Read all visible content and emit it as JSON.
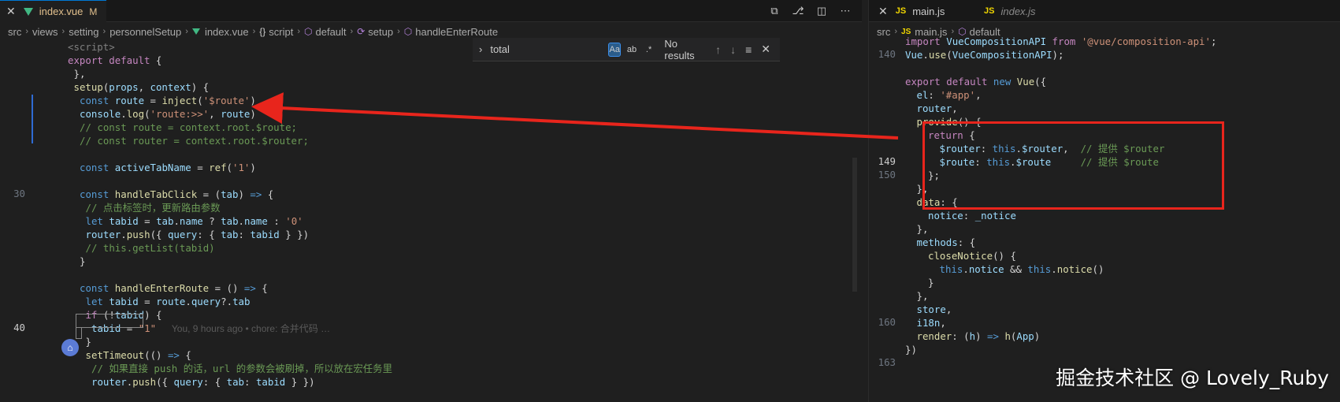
{
  "left": {
    "tab": {
      "label": "index.vue",
      "badge": "M"
    },
    "breadcrumb": [
      "src",
      "views",
      "setting",
      "personnelSetup",
      "index.vue",
      "script",
      "default",
      "setup",
      "handleEnterRoute"
    ],
    "find": {
      "query": "total",
      "results": "No results",
      "case_label": "Aa",
      "word_label": "ab",
      "regex_label": ".*"
    },
    "lines": [
      {
        "n": "",
        "tokens": [
          [
            "tag",
            "<script>"
          ]
        ],
        "indent": 4
      },
      {
        "n": "",
        "tokens": [
          [
            "kw2",
            "export"
          ],
          [
            "pl",
            " "
          ],
          [
            "kw2",
            "default"
          ],
          [
            "pl",
            " {"
          ]
        ],
        "indent": 4
      },
      {
        "n": "",
        "tokens": [
          [
            "pl",
            "},"
          ]
        ],
        "indent": 5
      },
      {
        "n": "",
        "tokens": [
          [
            "fn",
            "setup"
          ],
          [
            "pl",
            "("
          ],
          [
            "var",
            "props"
          ],
          [
            "pl",
            ", "
          ],
          [
            "var",
            "context"
          ],
          [
            "pl",
            ") {"
          ]
        ],
        "indent": 5
      },
      {
        "n": "",
        "tokens": [
          [
            "kw",
            "const"
          ],
          [
            "pl",
            " "
          ],
          [
            "var",
            "route"
          ],
          [
            "pl",
            " = "
          ],
          [
            "fn",
            "inject"
          ],
          [
            "pl",
            "("
          ],
          [
            "str",
            "'$route'"
          ],
          [
            "pl",
            ")"
          ]
        ],
        "indent": 6
      },
      {
        "n": "",
        "tokens": [
          [
            "var",
            "console"
          ],
          [
            "pl",
            "."
          ],
          [
            "fn",
            "log"
          ],
          [
            "pl",
            "("
          ],
          [
            "str",
            "'route:>>'"
          ],
          [
            "pl",
            ", "
          ],
          [
            "var",
            "route"
          ],
          [
            "pl",
            ")"
          ]
        ],
        "indent": 6
      },
      {
        "n": "",
        "tokens": [
          [
            "cm",
            "// const route = context.root.$route;"
          ]
        ],
        "indent": 6
      },
      {
        "n": "",
        "tokens": [
          [
            "cm",
            "// const router = context.root.$router;"
          ]
        ],
        "indent": 6
      },
      {
        "n": "",
        "tokens": [],
        "indent": 0
      },
      {
        "n": "",
        "tokens": [
          [
            "kw",
            "const"
          ],
          [
            "pl",
            " "
          ],
          [
            "var",
            "activeTabName"
          ],
          [
            "pl",
            " = "
          ],
          [
            "fn",
            "ref"
          ],
          [
            "pl",
            "("
          ],
          [
            "str",
            "'1'"
          ],
          [
            "pl",
            ")"
          ]
        ],
        "indent": 6
      },
      {
        "n": "",
        "tokens": [],
        "indent": 0
      },
      {
        "n": "30",
        "tokens": [
          [
            "kw",
            "const"
          ],
          [
            "pl",
            " "
          ],
          [
            "fn",
            "handleTabClick"
          ],
          [
            "pl",
            " = ("
          ],
          [
            "var",
            "tab"
          ],
          [
            "pl",
            ") "
          ],
          [
            "kw",
            "=>"
          ],
          [
            "pl",
            " {"
          ]
        ],
        "indent": 6
      },
      {
        "n": "",
        "tokens": [
          [
            "cm",
            "// 点击标签时，更新路由参数"
          ]
        ],
        "indent": 7
      },
      {
        "n": "",
        "tokens": [
          [
            "kw",
            "let"
          ],
          [
            "pl",
            " "
          ],
          [
            "var",
            "tabid"
          ],
          [
            "pl",
            " = "
          ],
          [
            "var",
            "tab"
          ],
          [
            "pl",
            "."
          ],
          [
            "var",
            "name"
          ],
          [
            "pl",
            " ? "
          ],
          [
            "var",
            "tab"
          ],
          [
            "pl",
            "."
          ],
          [
            "var",
            "name"
          ],
          [
            "pl",
            " : "
          ],
          [
            "str",
            "'0'"
          ]
        ],
        "indent": 7
      },
      {
        "n": "",
        "tokens": [
          [
            "var",
            "router"
          ],
          [
            "pl",
            "."
          ],
          [
            "fn",
            "push"
          ],
          [
            "pl",
            "({ "
          ],
          [
            "var",
            "query"
          ],
          [
            "pl",
            ": { "
          ],
          [
            "var",
            "tab"
          ],
          [
            "pl",
            ": "
          ],
          [
            "var",
            "tabid"
          ],
          [
            "pl",
            " } })"
          ]
        ],
        "indent": 7
      },
      {
        "n": "",
        "tokens": [
          [
            "cm",
            "// this.getList(tabid)"
          ]
        ],
        "indent": 7
      },
      {
        "n": "",
        "tokens": [
          [
            "pl",
            "}"
          ]
        ],
        "indent": 6
      },
      {
        "n": "",
        "tokens": [],
        "indent": 0
      },
      {
        "n": "",
        "tokens": [
          [
            "kw",
            "const"
          ],
          [
            "pl",
            " "
          ],
          [
            "fn",
            "handleEnterRoute"
          ],
          [
            "pl",
            " = () "
          ],
          [
            "kw",
            "=>"
          ],
          [
            "pl",
            " {"
          ]
        ],
        "indent": 6
      },
      {
        "n": "",
        "tokens": [
          [
            "kw",
            "let"
          ],
          [
            "pl",
            " "
          ],
          [
            "var",
            "tabid"
          ],
          [
            "pl",
            " = "
          ],
          [
            "var",
            "route"
          ],
          [
            "pl",
            "."
          ],
          [
            "var",
            "query"
          ],
          [
            "pl",
            "?."
          ],
          [
            "var",
            "tab"
          ]
        ],
        "indent": 7
      },
      {
        "n": "",
        "tokens": [
          [
            "kw2",
            "if"
          ],
          [
            "pl",
            " (!"
          ],
          [
            "var",
            "tabid"
          ],
          [
            "pl",
            ") {"
          ]
        ],
        "indent": 7
      },
      {
        "n": "40",
        "tokens": [
          [
            "var",
            "tabid"
          ],
          [
            "pl",
            " = "
          ],
          [
            "str",
            "\"1\""
          ]
        ],
        "indent": 8,
        "blame": "You, 9 hours ago • chore: 合并代码 …"
      },
      {
        "n": "",
        "tokens": [
          [
            "pl",
            "}"
          ]
        ],
        "indent": 7
      },
      {
        "n": "",
        "tokens": [
          [
            "fn",
            "setTimeout"
          ],
          [
            "pl",
            "(() "
          ],
          [
            "kw",
            "=>"
          ],
          [
            "pl",
            " {"
          ]
        ],
        "indent": 7
      },
      {
        "n": "",
        "tokens": [
          [
            "cm",
            "// 如果直接 push 的话，url 的参数会被刷掉，所以放在宏任务里"
          ]
        ],
        "indent": 8
      },
      {
        "n": "",
        "tokens": [
          [
            "var",
            "router"
          ],
          [
            "pl",
            "."
          ],
          [
            "fn",
            "push"
          ],
          [
            "pl",
            "({ "
          ],
          [
            "var",
            "query"
          ],
          [
            "pl",
            ": { "
          ],
          [
            "var",
            "tab"
          ],
          [
            "pl",
            ": "
          ],
          [
            "var",
            "tabid"
          ],
          [
            "pl",
            " } })"
          ]
        ],
        "indent": 8
      }
    ]
  },
  "right": {
    "tabs": [
      {
        "label": "main.js"
      },
      {
        "label": "index.js"
      }
    ],
    "breadcrumb": [
      "src",
      "main.js",
      "default"
    ],
    "lines": [
      {
        "n": "",
        "tokens": [
          [
            "kw2",
            "import"
          ],
          [
            "pl",
            " "
          ],
          [
            "var",
            "VueCompositionAPI"
          ],
          [
            "pl",
            " "
          ],
          [
            "kw2",
            "from"
          ],
          [
            "pl",
            " "
          ],
          [
            "str",
            "'@vue/composition-api'"
          ],
          [
            "pl",
            ";"
          ]
        ],
        "indent": 0
      },
      {
        "n": "140",
        "tokens": [
          [
            "var",
            "Vue"
          ],
          [
            "pl",
            "."
          ],
          [
            "fn",
            "use"
          ],
          [
            "pl",
            "("
          ],
          [
            "var",
            "VueCompositionAPI"
          ],
          [
            "pl",
            ");"
          ]
        ],
        "indent": 0
      },
      {
        "n": "",
        "tokens": [],
        "indent": 0
      },
      {
        "n": "",
        "tokens": [
          [
            "kw2",
            "export"
          ],
          [
            "pl",
            " "
          ],
          [
            "kw2",
            "default"
          ],
          [
            "pl",
            " "
          ],
          [
            "kw",
            "new"
          ],
          [
            "pl",
            " "
          ],
          [
            "fn",
            "Vue"
          ],
          [
            "pl",
            "({"
          ]
        ],
        "indent": 0
      },
      {
        "n": "",
        "tokens": [
          [
            "var",
            "el"
          ],
          [
            "pl",
            ": "
          ],
          [
            "str",
            "'#app'"
          ],
          [
            "pl",
            ","
          ]
        ],
        "indent": 1
      },
      {
        "n": "",
        "tokens": [
          [
            "var",
            "router"
          ],
          [
            "pl",
            ","
          ]
        ],
        "indent": 1
      },
      {
        "n": "",
        "tokens": [
          [
            "fn",
            "provide"
          ],
          [
            "pl",
            "() {"
          ]
        ],
        "indent": 1
      },
      {
        "n": "",
        "tokens": [
          [
            "kw2",
            "return"
          ],
          [
            "pl",
            " {"
          ]
        ],
        "indent": 2
      },
      {
        "n": "",
        "tokens": [
          [
            "var",
            "$router"
          ],
          [
            "pl",
            ": "
          ],
          [
            "kw",
            "this"
          ],
          [
            "pl",
            "."
          ],
          [
            "var",
            "$router"
          ],
          [
            "pl",
            ",  "
          ],
          [
            "cm",
            "// 提供 $router"
          ]
        ],
        "indent": 3
      },
      {
        "n": "149",
        "tokens": [
          [
            "var",
            "$route"
          ],
          [
            "pl",
            ": "
          ],
          [
            "kw",
            "this"
          ],
          [
            "pl",
            "."
          ],
          [
            "var",
            "$route"
          ],
          [
            "pl",
            "     "
          ],
          [
            "cm",
            "// 提供 $route"
          ]
        ],
        "indent": 3
      },
      {
        "n": "150",
        "tokens": [
          [
            "pl",
            "};"
          ]
        ],
        "indent": 2
      },
      {
        "n": "",
        "tokens": [
          [
            "pl",
            "},"
          ]
        ],
        "indent": 1
      },
      {
        "n": "",
        "tokens": [
          [
            "fn",
            "data"
          ],
          [
            "pl",
            ": {"
          ]
        ],
        "indent": 1
      },
      {
        "n": "",
        "tokens": [
          [
            "var",
            "notice"
          ],
          [
            "pl",
            ": "
          ],
          [
            "var",
            "_notice"
          ]
        ],
        "indent": 2
      },
      {
        "n": "",
        "tokens": [
          [
            "pl",
            "},"
          ]
        ],
        "indent": 1
      },
      {
        "n": "",
        "tokens": [
          [
            "var",
            "methods"
          ],
          [
            "pl",
            ": {"
          ]
        ],
        "indent": 1
      },
      {
        "n": "",
        "tokens": [
          [
            "fn",
            "closeNotice"
          ],
          [
            "pl",
            "() {"
          ]
        ],
        "indent": 2
      },
      {
        "n": "",
        "tokens": [
          [
            "kw",
            "this"
          ],
          [
            "pl",
            "."
          ],
          [
            "var",
            "notice"
          ],
          [
            "pl",
            " && "
          ],
          [
            "kw",
            "this"
          ],
          [
            "pl",
            "."
          ],
          [
            "fn",
            "notice"
          ],
          [
            "pl",
            "()"
          ]
        ],
        "indent": 3
      },
      {
        "n": "",
        "tokens": [
          [
            "pl",
            "}"
          ]
        ],
        "indent": 2
      },
      {
        "n": "",
        "tokens": [
          [
            "pl",
            "},"
          ]
        ],
        "indent": 1
      },
      {
        "n": "",
        "tokens": [
          [
            "var",
            "store"
          ],
          [
            "pl",
            ","
          ]
        ],
        "indent": 1
      },
      {
        "n": "160",
        "tokens": [
          [
            "var",
            "i18n"
          ],
          [
            "pl",
            ","
          ]
        ],
        "indent": 1
      },
      {
        "n": "",
        "tokens": [
          [
            "fn",
            "render"
          ],
          [
            "pl",
            ": ("
          ],
          [
            "var",
            "h"
          ],
          [
            "pl",
            ") "
          ],
          [
            "kw",
            "=>"
          ],
          [
            "pl",
            " "
          ],
          [
            "fn",
            "h"
          ],
          [
            "pl",
            "("
          ],
          [
            "var",
            "App"
          ],
          [
            "pl",
            ")"
          ]
        ],
        "indent": 1
      },
      {
        "n": "",
        "tokens": [
          [
            "pl",
            "})"
          ]
        ],
        "indent": 0
      },
      {
        "n": "163",
        "tokens": [],
        "indent": 0
      }
    ]
  },
  "watermark": "掘金技术社区 @ Lovely_Ruby",
  "colors": {
    "annotation": "#e8251c",
    "accent": "#0078d4"
  }
}
